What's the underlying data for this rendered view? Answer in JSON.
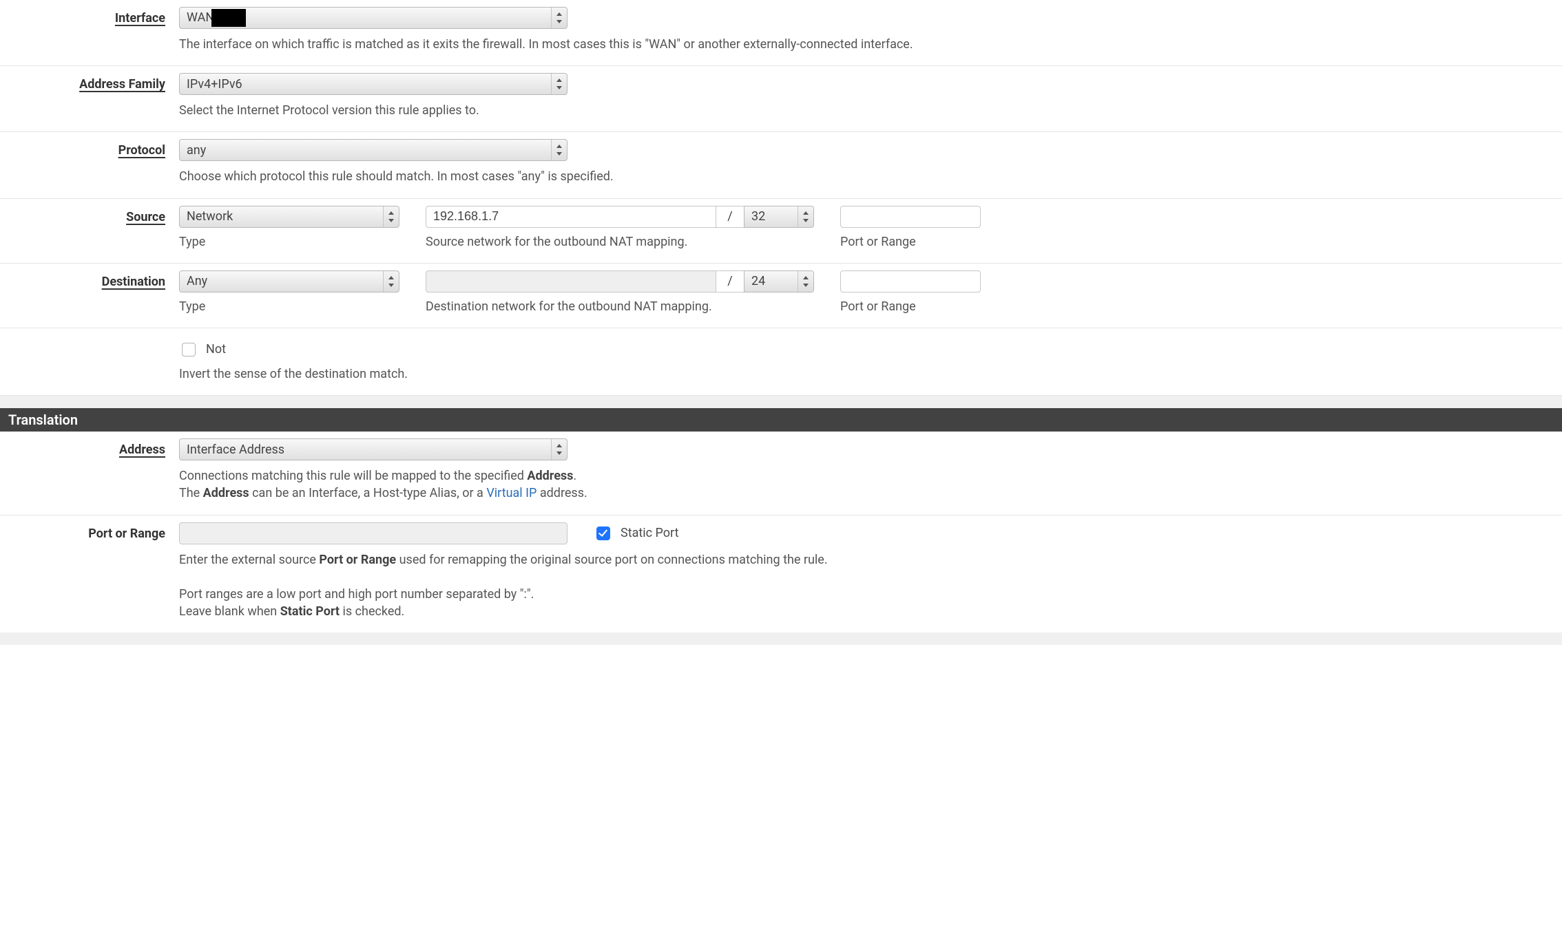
{
  "rows": {
    "interface": {
      "label": "Interface",
      "value": "WAN",
      "redacted": true,
      "help": "The interface on which traffic is matched as it exits the firewall. In most cases this is \"WAN\" or another externally-connected interface."
    },
    "addressFamily": {
      "label": "Address Family",
      "value": "IPv4+IPv6",
      "help": "Select the Internet Protocol version this rule applies to."
    },
    "protocol": {
      "label": "Protocol",
      "value": "any",
      "help": "Choose which protocol this rule should match. In most cases \"any\" is specified."
    },
    "source": {
      "label": "Source",
      "type": {
        "value": "Network",
        "sublabel": "Type"
      },
      "network": {
        "addr": "192.168.1.7",
        "cidr": "32",
        "slash": "/",
        "sublabel": "Source network for the outbound NAT mapping."
      },
      "port": {
        "value": "",
        "sublabel": "Port or Range"
      }
    },
    "destination": {
      "label": "Destination",
      "type": {
        "value": "Any",
        "sublabel": "Type"
      },
      "network": {
        "addr": "",
        "cidr": "24",
        "slash": "/",
        "sublabel": "Destination network for the outbound NAT mapping."
      },
      "port": {
        "value": "",
        "sublabel": "Port or Range"
      }
    },
    "not": {
      "check_label": "Not",
      "checked": false,
      "help": "Invert the sense of the destination match."
    }
  },
  "translation": {
    "header": "Translation",
    "address": {
      "label": "Address",
      "value": "Interface Address",
      "help_pre": "Connections matching this rule will be mapped to the specified ",
      "help_strong1": "Address",
      "help_post": ".",
      "help2_pre": "The ",
      "help2_strong": "Address",
      "help2_mid": " can be an Interface, a Host-type Alias, or a ",
      "help2_link": "Virtual IP",
      "help2_post": " address."
    },
    "port": {
      "label": "Port or Range",
      "value": "",
      "static_label": "Static Port",
      "static_checked": true,
      "help1_pre": "Enter the external source ",
      "help1_strong": "Port or Range",
      "help1_post": " used for remapping the original source port on connections matching the rule.",
      "help2": "Port ranges are a low port and high port number separated by \":\".",
      "help3_pre": "Leave blank when ",
      "help3_strong": "Static Port",
      "help3_post": " is checked."
    }
  }
}
